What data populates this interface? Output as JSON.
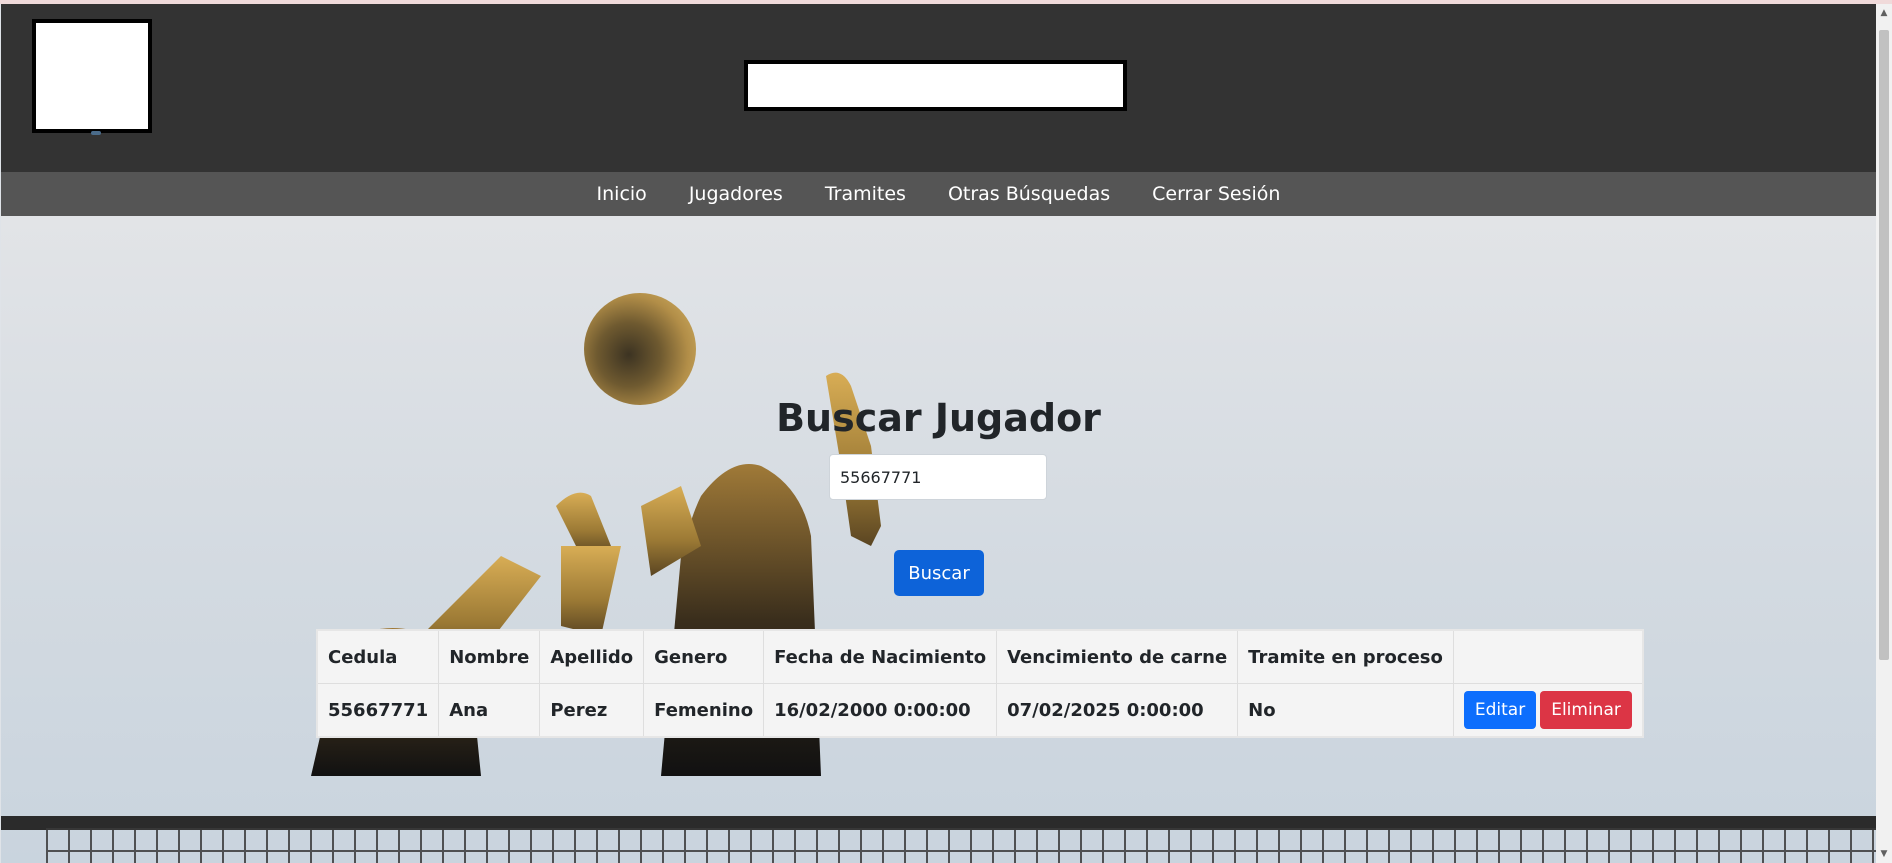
{
  "nav": {
    "items": [
      "Inicio",
      "Jugadores",
      "Tramites",
      "Otras Búsquedas",
      "Cerrar Sesión"
    ]
  },
  "main": {
    "title": "Buscar Jugador",
    "search_value": "55667771",
    "search_button": "Buscar"
  },
  "table": {
    "headers": [
      "Cedula",
      "Nombre",
      "Apellido",
      "Genero",
      "Fecha de Nacimiento",
      "Vencimiento de carne",
      "Tramite en proceso"
    ],
    "rows": [
      [
        "55667771",
        "Ana",
        "Perez",
        "Femenino",
        "16/02/2000 0:00:00",
        "07/02/2025 0:00:00",
        "No"
      ]
    ],
    "edit_label": "Editar",
    "delete_label": "Eliminar"
  },
  "colors": {
    "header_bg": "#333333",
    "nav_bg": "#555555",
    "primary": "#0d6efd",
    "danger": "#dc3545"
  }
}
